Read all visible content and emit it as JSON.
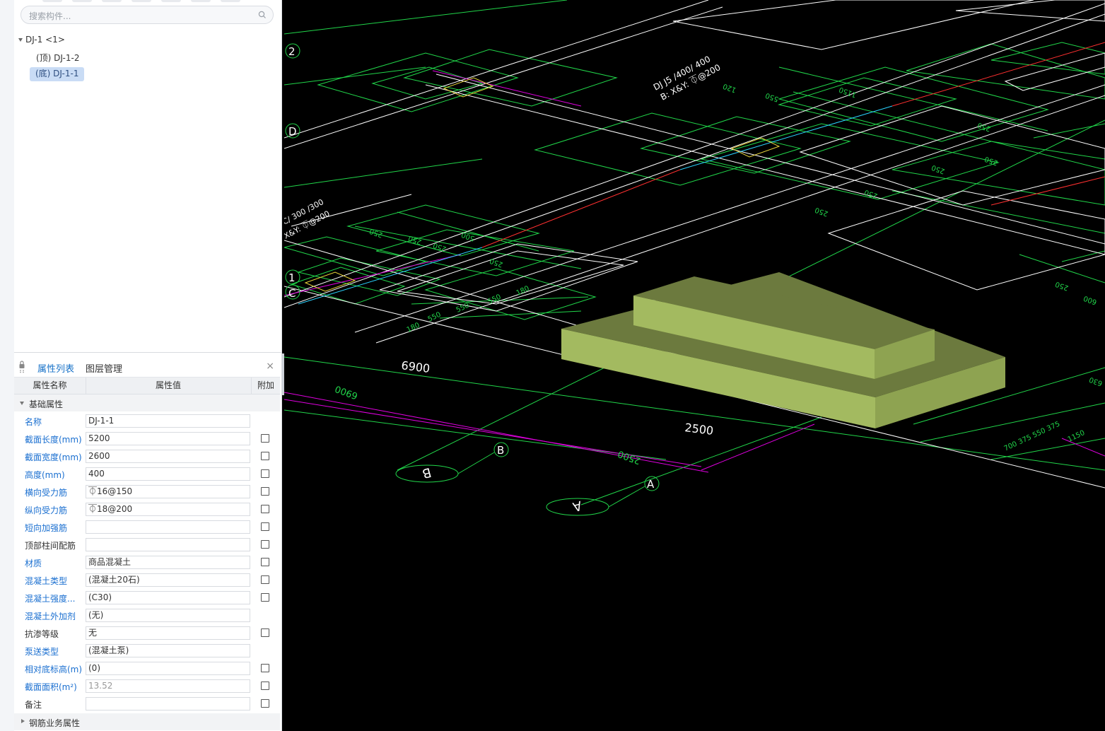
{
  "search": {
    "placeholder": "搜索构件..."
  },
  "tree": {
    "root": "DJ-1 <1>",
    "children": [
      "(顶) DJ-1-2",
      "(底) DJ-1-1"
    ]
  },
  "panel": {
    "tabs": [
      "属性列表",
      "图层管理"
    ],
    "close": "×",
    "columns": [
      "属性名称",
      "属性值",
      "附加"
    ],
    "group_basic": "基础属性",
    "group_rebar": "钢筋业务属性",
    "rows": [
      {
        "name": "名称",
        "value": "DJ-1-1",
        "blue": true,
        "check": false
      },
      {
        "name": "截面长度(mm)",
        "value": "5200",
        "blue": true,
        "check": true
      },
      {
        "name": "截面宽度(mm)",
        "value": "2600",
        "blue": true,
        "check": true
      },
      {
        "name": "高度(mm)",
        "value": "400",
        "blue": true,
        "check": true
      },
      {
        "name": "横向受力筋",
        "value": "⏁16@150",
        "blue": true,
        "check": true
      },
      {
        "name": "纵向受力筋",
        "value": "⏁18@200",
        "blue": true,
        "check": true
      },
      {
        "name": "短向加强筋",
        "value": "",
        "blue": true,
        "check": true
      },
      {
        "name": "顶部柱间配筋",
        "value": "",
        "blue": false,
        "check": true
      },
      {
        "name": "材质",
        "value": "商品混凝土",
        "blue": true,
        "check": true
      },
      {
        "name": "混凝土类型",
        "value": "(混凝土20石)",
        "blue": true,
        "check": true
      },
      {
        "name": "混凝土强度...",
        "value": "(C30)",
        "blue": true,
        "check": true
      },
      {
        "name": "混凝土外加剂",
        "value": "(无)",
        "blue": true,
        "check": false
      },
      {
        "name": "抗渗等级",
        "value": "无",
        "blue": false,
        "check": true
      },
      {
        "name": "泵送类型",
        "value": "(混凝土泵)",
        "blue": true,
        "check": false
      },
      {
        "name": "相对底标高(m)",
        "value": "(0)",
        "blue": true,
        "check": true
      },
      {
        "name": "截面面积(m²)",
        "value": "13.52",
        "blue": true,
        "check": true,
        "grey": true
      },
      {
        "name": "备注",
        "value": "",
        "blue": false,
        "check": true
      }
    ]
  },
  "viewport": {
    "axis_labels": [
      "2",
      "D",
      "1",
      "C",
      "B",
      "A"
    ],
    "axis_bubbles": [
      "B",
      "A"
    ],
    "dimensions": [
      "6900",
      "2500",
      "6900",
      "2500"
    ],
    "annotations": [
      "DJ J5 /400/ 400",
      "B: X&Y: ⏁@200",
      "C/ 300 /300",
      "X&Y: ⏁@200"
    ],
    "colors": {
      "grid_green": "#21d64a",
      "wall_white": "#ffffff",
      "axis_magenta": "#e000e0",
      "slab_light": "#a3ba60",
      "slab_dark": "#6c7a3e",
      "slab_mid": "#8ea351",
      "yellow": "#e8d33a"
    }
  }
}
